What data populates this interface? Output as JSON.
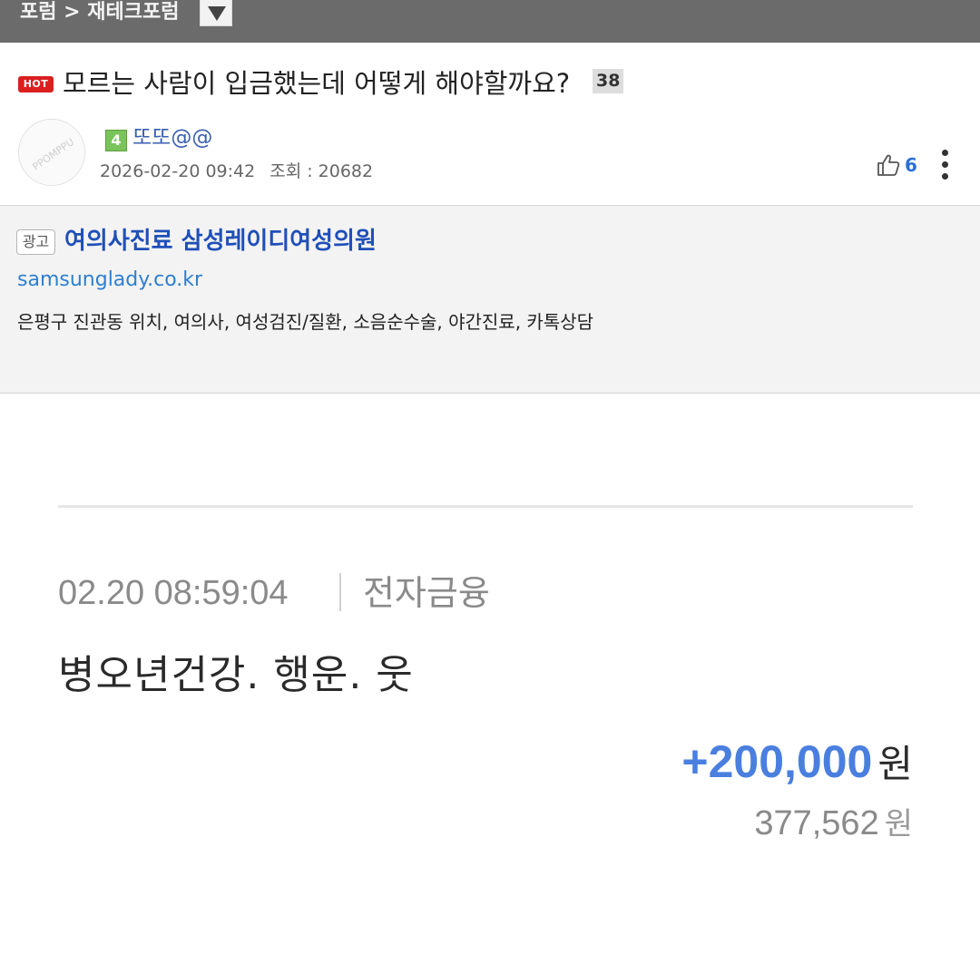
{
  "topbar": {
    "breadcrumb": "포럼 > 재테크포럼"
  },
  "post": {
    "hot_label": "HOT",
    "title": "모르는 사람이 입금했는데 어떻게 해야할까요?",
    "comment_count": "38",
    "author": {
      "level": "4",
      "nickname": "또또@@",
      "avatar_watermark": "PPOMPPU"
    },
    "datetime": "2026-02-20 09:42",
    "views_label": "조회 : 20682",
    "likes": "6"
  },
  "ad": {
    "label": "광고",
    "title": "여의사진료 삼성레이디여성의원",
    "url": "samsunglady.co.kr",
    "description": "은평구 진관동 위치, 여의사, 여성검진/질환, 소음순수술, 야간진료, 카톡상담"
  },
  "transaction": {
    "time": "02.20 08:59:04",
    "type": "전자금융",
    "memo": "병오년건강.  행운.  웃",
    "amount": "+200,000",
    "amount_unit": "원",
    "balance": "377,562",
    "balance_unit": "원"
  },
  "colors": {
    "topbar": "#6b6b6b",
    "hot_badge": "#d9201f",
    "nickname": "#3a5fb0",
    "like": "#2b6fd6",
    "ad_title": "#1f4fb8",
    "ad_url": "#2e7fd0",
    "amount": "#4a7fe0"
  },
  "icons": {
    "dropdown": "triangle-down-icon",
    "like": "thumbs-up-icon",
    "more": "vertical-dots-icon"
  }
}
